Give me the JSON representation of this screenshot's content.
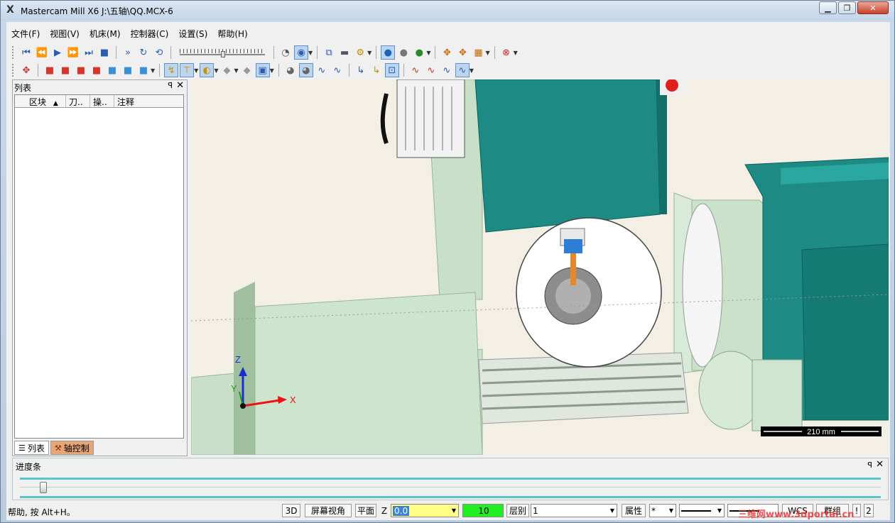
{
  "window": {
    "title": "Mastercam Mill X6  J:\\五轴\\QQ.MCX-6",
    "app_icon": "X"
  },
  "menu": [
    "文件(F)",
    "视图(V)",
    "机床(M)",
    "控制器(C)",
    "设置(S)",
    "帮助(H)"
  ],
  "left_panel": {
    "title": "列表",
    "columns": [
      "区块",
      "刀..",
      "操..",
      "注释"
    ],
    "tabs": [
      "列表",
      "轴控制"
    ]
  },
  "viewport": {
    "axis_z": "Z",
    "axis_y": "Y",
    "axis_x": "X",
    "scale_label": "210 mm"
  },
  "progress": {
    "title": "进度条",
    "value": 0.02
  },
  "status": {
    "help": "帮助, 按 Alt+H。",
    "btn_3d": "3D",
    "btn_view": "屏幕视角",
    "btn_plane": "平面",
    "z_label": "Z",
    "z_value": "0.0",
    "color_value": "10",
    "level_label": "层别",
    "level_value": "1",
    "attr_label": "属性",
    "point_style": "*",
    "wcs_label": "WCS",
    "group_label": "群组",
    "btn_1": "!",
    "btn_2": "2",
    "watermark": "三维网www.3dportal.cn"
  },
  "colors": {
    "machine_teal": "#1d8a84",
    "machine_light": "#c9e2c9",
    "accent_blue": "#3b82d9",
    "z_field": "#ffff88",
    "color_field": "#22ee22"
  }
}
